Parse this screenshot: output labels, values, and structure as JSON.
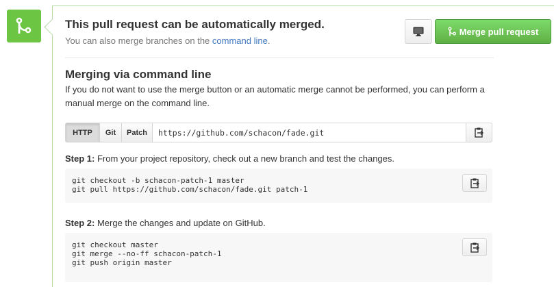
{
  "header": {
    "title": "This pull request can be automatically merged.",
    "subtitle_prefix": "You can also merge branches on the",
    "subtitle_link": "command line",
    "subtitle_suffix": ".",
    "merge_button_label": "Merge pull request"
  },
  "icons": {
    "merge_badge": "git-merge-icon",
    "desktop": "desktop-icon",
    "clipboard": "clipboard-icon"
  },
  "colors": {
    "merge_green": "#6cc644",
    "link_blue": "#4078c0"
  },
  "command_line": {
    "title": "Merging via command line",
    "description": "If you do not want to use the merge button or an automatic merge cannot be performed, you can perform a manual merge on the command line.",
    "protocols": [
      "HTTP",
      "Git",
      "Patch"
    ],
    "active_protocol": "HTTP",
    "url": "https://github.com/schacon/fade.git"
  },
  "steps": [
    {
      "label": "Step 1:",
      "text": "From your project repository, check out a new branch and test the changes.",
      "code": [
        "git checkout -b schacon-patch-1 master",
        "git pull https://github.com/schacon/fade.git patch-1"
      ]
    },
    {
      "label": "Step 2:",
      "text": "Merge the changes and update on GitHub.",
      "code": [
        "git checkout master",
        "git merge --no-ff schacon-patch-1",
        "git push origin master"
      ]
    }
  ]
}
